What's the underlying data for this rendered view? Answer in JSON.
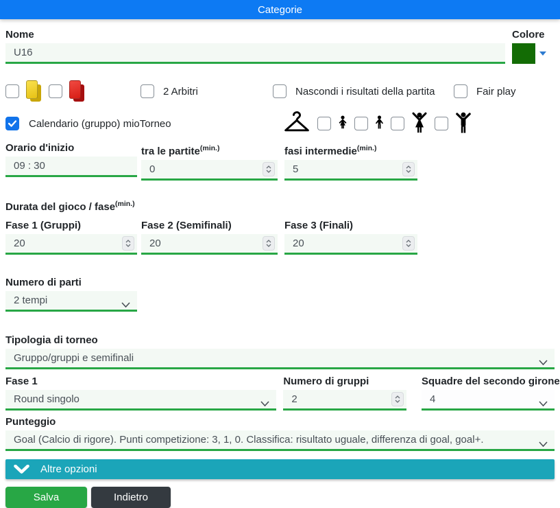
{
  "header": {
    "title": "Categorie"
  },
  "nome": {
    "label": "Nome",
    "value": "U16"
  },
  "colore": {
    "label": "Colore",
    "value": "#136c05"
  },
  "penalty_cards": {
    "yellow": {
      "checked": false
    },
    "red": {
      "checked": false
    }
  },
  "options_row": {
    "arbitri": {
      "label": "2 Arbitri",
      "checked": false
    },
    "nascondi_risultati": {
      "label": "Nascondi i risultati della partita",
      "checked": false
    },
    "fair_play": {
      "label": "Fair play",
      "checked": false
    }
  },
  "calendario": {
    "label": "Calendario (gruppo) mioTorneo",
    "checked": true
  },
  "apparel": {
    "hanger_icon": "clothes-hanger",
    "items": [
      {
        "icon": "girl-figure",
        "checked": false
      },
      {
        "icon": "boy-figure",
        "checked": false
      },
      {
        "icon": "woman-arms-up-figure",
        "checked": false
      },
      {
        "icon": "man-arms-up-figure",
        "checked": false
      }
    ]
  },
  "timing": {
    "orario_inizio": {
      "label": "Orario d'inizio",
      "value": "09 : 30"
    },
    "tra_le_partite": {
      "label": "tra le partite",
      "unit": "(min.)",
      "value": "0"
    },
    "fasi_intermedie": {
      "label": "fasi intermedie",
      "unit": "(min.)",
      "value": "5"
    }
  },
  "durata": {
    "heading": "Durata del gioco / fase",
    "unit": "(min.)",
    "fase1": {
      "label": "Fase 1 (Gruppi)",
      "value": "20"
    },
    "fase2": {
      "label": "Fase 2 (Semifinali)",
      "value": "20"
    },
    "fase3": {
      "label": "Fase 3 (Finali)",
      "value": "20"
    }
  },
  "numero_parti": {
    "label": "Numero di parti",
    "value": "2 tempi"
  },
  "tipologia": {
    "label": "Tipologia di torneo",
    "value": "Gruppo/gruppi e semifinali"
  },
  "fase_config": {
    "fase1": {
      "label": "Fase 1",
      "value": "Round singolo"
    },
    "numero_gruppi": {
      "label": "Numero di gruppi",
      "value": "2"
    },
    "squadre_secondo_girone": {
      "label": "Squadre del secondo girone",
      "value": "4"
    }
  },
  "punteggio": {
    "label": "Punteggio",
    "value": "Goal (Calcio di rigore). Punti competizione: 3, 1, 0. Classifica: risultato uguale, differenza di goal, goal+."
  },
  "altre_opzioni": {
    "label": "Altre opzioni"
  },
  "actions": {
    "salva": "Salva",
    "indietro": "Indietro"
  },
  "colors": {
    "primary_blue": "#0d7af3",
    "accent_green": "#28a745",
    "teal_bar": "#1ba5b9",
    "dark_button": "#343a40",
    "checkbox_checked_blue": "#1173ea",
    "swatch_green": "#136c05"
  }
}
